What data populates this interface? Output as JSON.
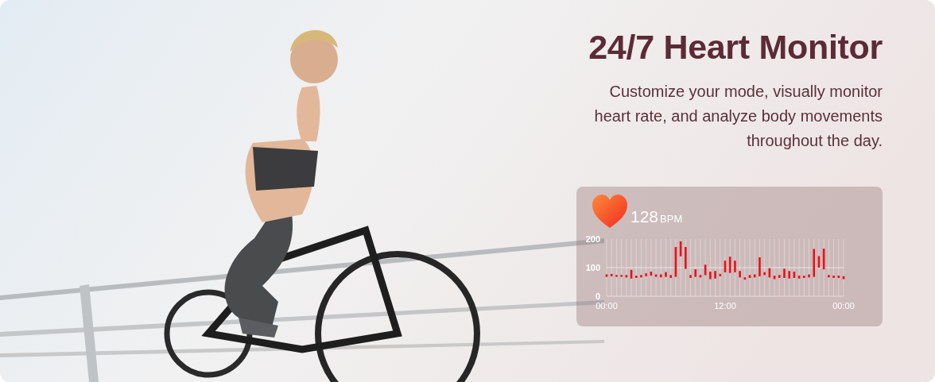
{
  "banner": {
    "kind": "picture",
    "title": "24/7 Heart Monitor",
    "description": "Customize your mode, visually monitor heart rate, and analyze body movements throughout the day."
  },
  "heart_card": {
    "value": "128",
    "unit": "BPM",
    "chart_data": {
      "type": "candlestick",
      "color": "#e8121a",
      "ref_lines": [
        {
          "axis": "y",
          "value": 100
        }
      ],
      "ylim": [
        0,
        200
      ],
      "yticks": [
        0,
        100,
        200
      ],
      "xlim": [
        0,
        24
      ],
      "xticks": [
        {
          "value": 0,
          "label": "00:00"
        },
        {
          "value": 12,
          "label": "12:00"
        },
        {
          "value": 24,
          "label": "00:00"
        }
      ],
      "x": [
        0,
        0.5,
        1,
        1.5,
        2,
        2.5,
        3,
        3.5,
        4,
        4.5,
        5,
        5.5,
        6,
        6.5,
        7,
        7.5,
        8,
        8.5,
        9,
        9.5,
        10,
        10.5,
        11,
        11.5,
        12,
        12.5,
        13,
        13.5,
        14,
        14.5,
        15,
        15.5,
        16,
        16.5,
        17,
        17.5,
        18,
        18.5,
        19,
        19.5,
        20,
        20.5,
        21,
        21.5,
        22,
        22.5,
        23,
        23.5,
        24
      ],
      "ohlc": [
        [
          68,
          76,
          68,
          76
        ],
        [
          70,
          78,
          70,
          78
        ],
        [
          68,
          74,
          68,
          74
        ],
        [
          68,
          74,
          68,
          74
        ],
        [
          66,
          74,
          66,
          74
        ],
        [
          62,
          92,
          62,
          92
        ],
        [
          64,
          72,
          64,
          72
        ],
        [
          66,
          74,
          66,
          74
        ],
        [
          70,
          80,
          70,
          80
        ],
        [
          72,
          86,
          72,
          86
        ],
        [
          68,
          76,
          68,
          76
        ],
        [
          66,
          76,
          66,
          76
        ],
        [
          68,
          84,
          68,
          84
        ],
        [
          64,
          74,
          64,
          74
        ],
        [
          68,
          172,
          68,
          172
        ],
        [
          140,
          192,
          140,
          192
        ],
        [
          96,
          172,
          96,
          172
        ],
        [
          64,
          74,
          64,
          74
        ],
        [
          68,
          94,
          68,
          94
        ],
        [
          66,
          74,
          66,
          74
        ],
        [
          74,
          110,
          74,
          110
        ],
        [
          60,
          86,
          60,
          86
        ],
        [
          62,
          88,
          62,
          88
        ],
        [
          70,
          78,
          70,
          78
        ],
        [
          84,
          124,
          84,
          124
        ],
        [
          82,
          138,
          82,
          138
        ],
        [
          84,
          124,
          84,
          124
        ],
        [
          66,
          88,
          66,
          88
        ],
        [
          58,
          66,
          58,
          66
        ],
        [
          64,
          74,
          64,
          74
        ],
        [
          66,
          76,
          66,
          76
        ],
        [
          70,
          136,
          70,
          136
        ],
        [
          74,
          84,
          74,
          84
        ],
        [
          66,
          98,
          66,
          98
        ],
        [
          60,
          72,
          60,
          72
        ],
        [
          64,
          74,
          64,
          74
        ],
        [
          64,
          96,
          64,
          96
        ],
        [
          62,
          88,
          62,
          88
        ],
        [
          64,
          86,
          64,
          86
        ],
        [
          62,
          72,
          62,
          72
        ],
        [
          64,
          72,
          64,
          72
        ],
        [
          66,
          76,
          66,
          76
        ],
        [
          68,
          165,
          68,
          165
        ],
        [
          100,
          140,
          100,
          140
        ],
        [
          94,
          166,
          94,
          166
        ],
        [
          66,
          74,
          66,
          74
        ],
        [
          64,
          72,
          64,
          72
        ],
        [
          64,
          72,
          64,
          72
        ],
        [
          60,
          70,
          60,
          70
        ]
      ]
    }
  }
}
